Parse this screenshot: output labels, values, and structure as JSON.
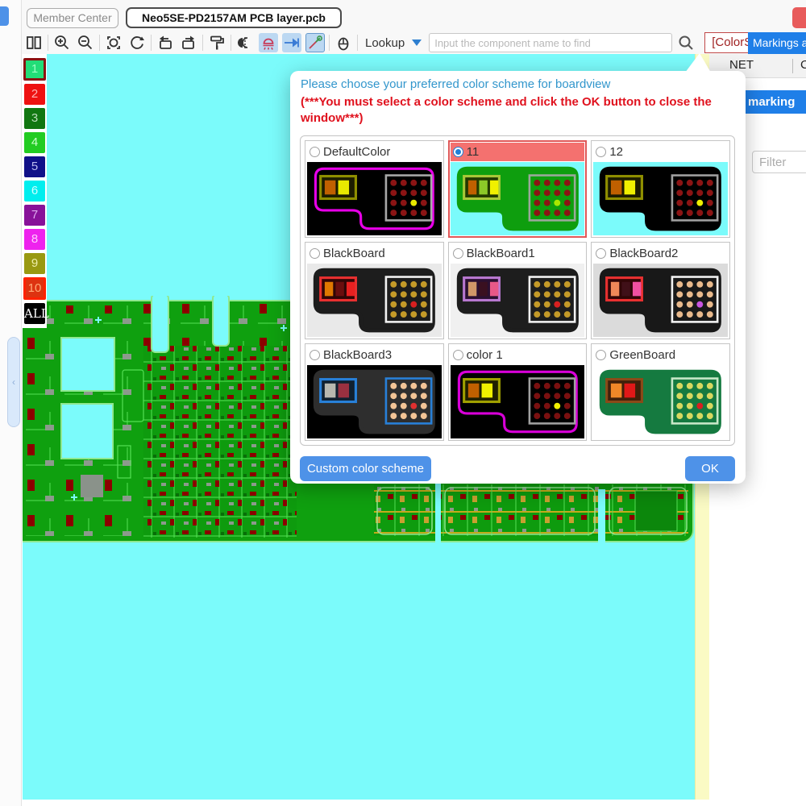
{
  "window": {
    "member_center_label": "Member Center",
    "file_tab_label": "Neo5SE-PD2157AM PCB layer.pcb"
  },
  "toolbar": {
    "lookup_label": "Lookup",
    "search_placeholder": "Input the component name to find",
    "color_scheme_button_label": "[ColorScheme]",
    "markings_button_label": "Markings a",
    "icon_names": [
      "split-view",
      "zoom-in",
      "zoom-out",
      "locate",
      "refresh",
      "rotate-left",
      "rotate-right",
      "paint-roller",
      "mirror-flip",
      "diode-lamp",
      "diode-direction",
      "measure-wand",
      "mouse-mode"
    ]
  },
  "right_panel": {
    "net_tab_label": "NET",
    "second_tab_label": "C",
    "my_marking_button_label": "My marking",
    "filter_placeholder": "Filter"
  },
  "layer_sidebar": {
    "items": [
      {
        "label": "1",
        "color": "#22DD77",
        "border": "#8B1111",
        "text_color": "#99FFC2",
        "selected": true,
        "serif": false
      },
      {
        "label": "2",
        "color": "#EE1111",
        "border": "",
        "text_color": "#FFB3B3",
        "selected": false,
        "serif": false
      },
      {
        "label": "3",
        "color": "#117711",
        "border": "",
        "text_color": "#BBDDBB",
        "selected": false,
        "serif": false
      },
      {
        "label": "4",
        "color": "#22CC22",
        "border": "",
        "text_color": "#CCFFCC",
        "selected": false,
        "serif": false
      },
      {
        "label": "5",
        "color": "#101088",
        "border": "",
        "text_color": "#BBBBEE",
        "selected": false,
        "serif": false
      },
      {
        "label": "6",
        "color": "#00EEEE",
        "border": "",
        "text_color": "#CCFFFF",
        "selected": false,
        "serif": false
      },
      {
        "label": "7",
        "color": "#881199",
        "border": "",
        "text_color": "#DDAAEE",
        "selected": false,
        "serif": false
      },
      {
        "label": "8",
        "color": "#EE22EE",
        "border": "",
        "text_color": "#FFCCFF",
        "selected": false,
        "serif": false
      },
      {
        "label": "9",
        "color": "#999911",
        "border": "",
        "text_color": "#EEEEAA",
        "selected": false,
        "serif": false
      },
      {
        "label": "10",
        "color": "#DD3311",
        "border": "#FF2200",
        "text_color": "#FFAA77",
        "selected": true,
        "serif": false
      },
      {
        "label": "ALL",
        "color": "#000000",
        "border": "",
        "text_color": "#FFFFFF",
        "selected": false,
        "serif": true
      }
    ]
  },
  "dialog": {
    "title": "Please choose your preferred color scheme for boardview",
    "warning": "(***You must select a color scheme and click the OK button to close the window***)",
    "custom_button_label": "Custom color scheme",
    "ok_button_label": "OK",
    "selected_header_color": "#F4716F",
    "options": [
      {
        "name": "DefaultColor",
        "selected": false,
        "preview": {
          "bg": "#000000",
          "board_style": "outline",
          "board_color": "#E800E8",
          "comp_stroke": "#8F8F00",
          "comp_fill": "#1C1C00",
          "comp_squares": [
            "#C06000",
            "#E8E800"
          ],
          "ic_stroke": "#A8A8A8",
          "pad_color": "#8B1414",
          "special_pad": "#E8E800"
        }
      },
      {
        "name": "11",
        "selected": true,
        "preview": {
          "bg": "#7BFBFB",
          "board_style": "fill",
          "board_color": "#0E9E0E",
          "comp_stroke": "#A8C838",
          "comp_fill": "#223A00",
          "comp_squares": [
            "#C06000",
            "#8CC828",
            "#F0F000"
          ],
          "ic_stroke": "#9AA89A",
          "pad_color": "#8B1414",
          "special_pad": "#A8E800"
        }
      },
      {
        "name": "12",
        "selected": false,
        "preview": {
          "bg": "#7BFBFB",
          "board_style": "fill",
          "board_color": "#000000",
          "comp_stroke": "#8F8F00",
          "comp_fill": "#1C1C00",
          "comp_squares": [
            "#C06000",
            "#F0F000"
          ],
          "ic_stroke": "#A0A0A0",
          "pad_color": "#8B1414",
          "special_pad": "#F0F000"
        }
      },
      {
        "name": "BlackBoard",
        "selected": false,
        "preview": {
          "bg": "#E9E9E9",
          "board_style": "fill",
          "board_color": "#1D1D1D",
          "comp_stroke": "#E83030",
          "comp_fill": "#300606",
          "comp_squares": [
            "#E07800",
            "#6A0E0E",
            "#E82020"
          ],
          "ic_stroke": "#F2F2F2",
          "pad_color": "#C49A28",
          "special_pad": "#D82020"
        }
      },
      {
        "name": "BlackBoard1",
        "selected": false,
        "preview": {
          "bg": "#F0F0F0",
          "board_style": "fill",
          "board_color": "#1D1D1D",
          "comp_stroke": "#B878D0",
          "comp_fill": "#2A1030",
          "comp_squares": [
            "#D09868",
            "#3A1020",
            "#E85888"
          ],
          "ic_stroke": "#F2F2F2",
          "pad_color": "#C49A28",
          "special_pad": "#D82020"
        }
      },
      {
        "name": "BlackBoard2",
        "selected": false,
        "preview": {
          "bg": "#DBDBDB",
          "board_style": "fill",
          "board_color": "#181818",
          "comp_stroke": "#E83030",
          "comp_fill": "#300606",
          "comp_squares": [
            "#F08858",
            "#401018",
            "#F050A0"
          ],
          "ic_stroke": "#F2F2F2",
          "pad_color": "#E8B98C",
          "special_pad": "#C855E0"
        }
      },
      {
        "name": "BlackBoard3",
        "selected": false,
        "preview": {
          "bg": "#000000",
          "board_style": "fill",
          "board_color": "#2E2E2E",
          "comp_stroke": "#2880D8",
          "comp_fill": "#102030",
          "comp_squares": [
            "#B8B8B0",
            "#9A3040"
          ],
          "ic_stroke": "#2880D8",
          "pad_color": "#F2C496",
          "special_pad": "#E03030"
        }
      },
      {
        "name": "color 1",
        "selected": false,
        "preview": {
          "bg": "#000000",
          "board_style": "outline",
          "board_color": "#D800D8",
          "comp_stroke": "#A0A000",
          "comp_fill": "#202000",
          "comp_squares": [
            "#C06000",
            "#F0F000"
          ],
          "ic_stroke": "#A0A0A0",
          "pad_color": "#7A1010",
          "special_pad": "#F0F000"
        }
      },
      {
        "name": "GreenBoard",
        "selected": false,
        "preview": {
          "bg": "#FFFFFF",
          "board_style": "fill",
          "board_color": "#157A40",
          "comp_stroke": "#8A4A18",
          "comp_fill": "#40200A",
          "comp_squares": [
            "#F08828",
            "#E01818"
          ],
          "ic_stroke": "#C8E8C8",
          "pad_color": "#D8D860",
          "special_pad": "#D82020"
        }
      }
    ]
  },
  "colors": {
    "canvas_background": "#7BFBFB",
    "pcb_green": "#0FA00F",
    "accent_blue": "#4E92E8",
    "button_blue": "#1F7FE8",
    "warning_red": "#E0121E",
    "title_blue": "#3296CC",
    "selected_option_border": "#E05858",
    "right_strip_yellow": "#FAFAC4"
  }
}
